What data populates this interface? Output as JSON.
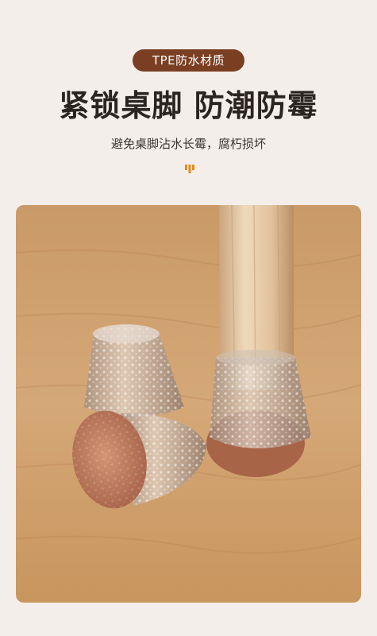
{
  "badge": {
    "label": "TPE防水材质"
  },
  "headline": {
    "text": "紧锁桌脚 防潮防霉"
  },
  "subheadline": {
    "text": "避免桌脚沾水长霉，腐朽损坏"
  },
  "icons": {
    "decoration": "bar-chart-decoration-icon"
  },
  "colors": {
    "background": "#f3eeea",
    "badge": "#7a3f22",
    "accent": "#e58a1f",
    "headline": "#2a2422"
  }
}
